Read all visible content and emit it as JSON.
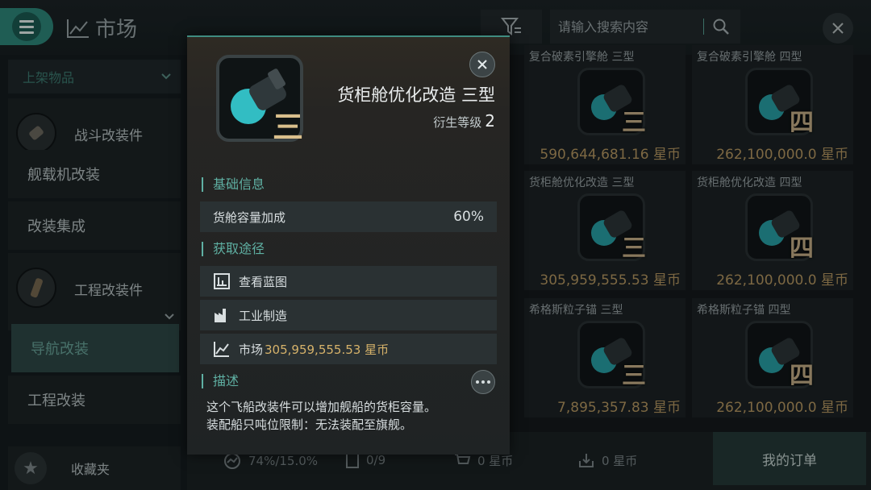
{
  "topbar": {
    "title": "市场",
    "search_placeholder": "请输入搜索内容"
  },
  "sidebar": {
    "dropdown_label": "上架物品",
    "categories": [
      {
        "label": "战斗改装件"
      },
      {
        "label": "工程改装件"
      }
    ],
    "items": [
      {
        "label": "舰载机改装"
      },
      {
        "label": "改装集成"
      },
      {
        "label": "导航改装"
      },
      {
        "label": "工程改装"
      }
    ],
    "favorites_label": "收藏夹"
  },
  "grid": {
    "cards": [
      {
        "name": "复合破素引擎舱 三型",
        "roman": "三",
        "price": "590,644,681.16 星币"
      },
      {
        "name": "复合破素引擎舱 四型",
        "roman": "四",
        "price": "262,100,000.0 星币"
      },
      {
        "name": "货柜舱优化改造 三型",
        "roman": "三",
        "price": "305,959,555.53 星币"
      },
      {
        "name": "货柜舱优化改造 四型",
        "roman": "四",
        "price": "262,100,000.0 星币"
      },
      {
        "name": "希格斯粒子锚 三型",
        "roman": "三",
        "price": "7,895,357.83 星币"
      },
      {
        "name": "希格斯粒子锚 四型",
        "roman": "四",
        "price": "262,100,000.0 星币"
      }
    ]
  },
  "bottombar": {
    "capacity": "74%/15.0%",
    "orders_count": "0/9",
    "cart_value": "0 星币",
    "pending_value": "0 星币",
    "my_orders_label": "我的订单"
  },
  "popup": {
    "roman": "三",
    "title": "货柜舱优化改造 三型",
    "level_label": "衍生等级",
    "level_value": "2",
    "basic_info_heading": "基础信息",
    "stat_label": "货舱容量加成",
    "stat_value": "60%",
    "source_heading": "获取途径",
    "source_blueprint": "查看蓝图",
    "source_industry": "工业制造",
    "source_market_label": "市场",
    "source_market_price": "305,959,555.53 星币",
    "desc_heading": "描述",
    "desc_line1": "这个飞船改装件可以增加舰船的货柜容量。",
    "desc_line2": "装配船只吨位限制：无法装配至旗舰。"
  },
  "colors": {
    "accent": "#2e8a7c",
    "gold": "#d6b26a",
    "heading": "#5fb0a3"
  }
}
